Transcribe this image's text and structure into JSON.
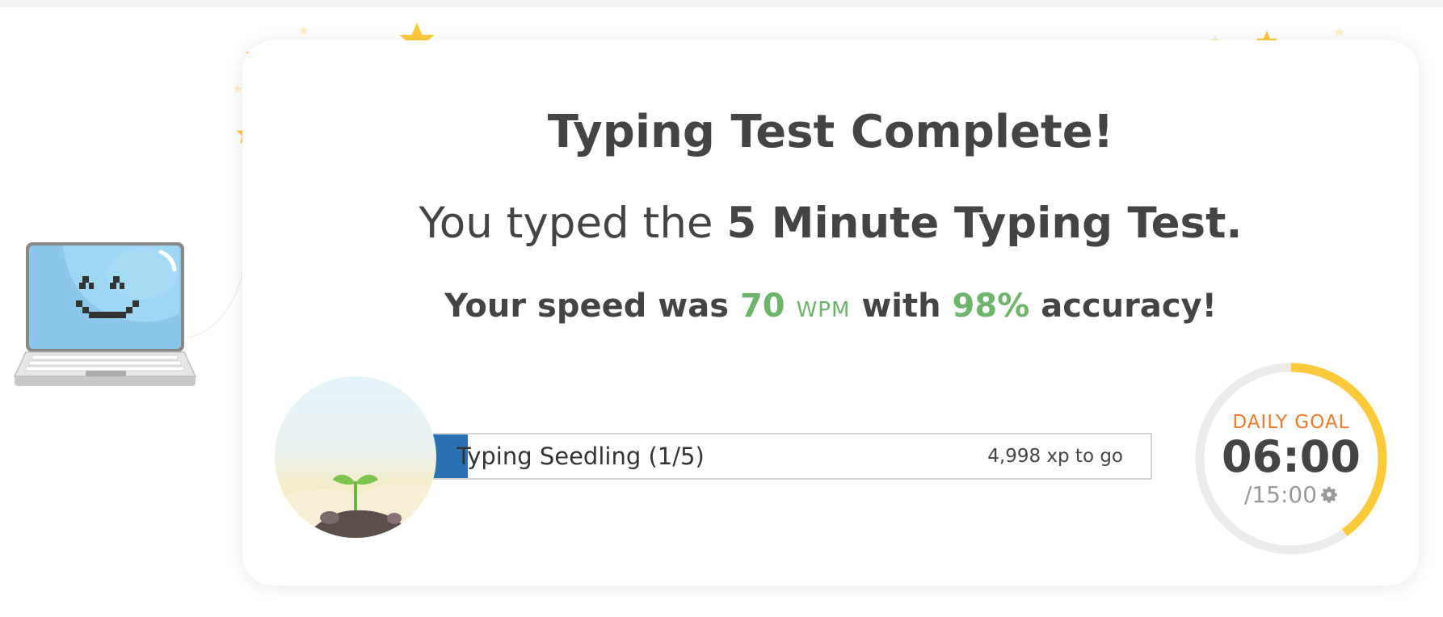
{
  "result": {
    "title": "Typing Test Complete!",
    "subtitle_prefix": "You typed the",
    "test_name": "5 Minute Typing Test.",
    "speed_prefix": "Your speed was",
    "wpm_value": "70",
    "wpm_unit": "WPM",
    "speed_middle": "with",
    "accuracy_value": "98%",
    "speed_suffix": "accuracy!"
  },
  "progress": {
    "level_label": "Typing Seedling (1/5)",
    "xp_to_go": "4,998 xp to go",
    "fill_fraction": 0.05
  },
  "daily_goal": {
    "label": "DAILY GOAL",
    "time": "06:00",
    "total": "/15:00",
    "progress_fraction": 0.4
  },
  "colors": {
    "accent_green": "#6cb56b",
    "progress_blue": "#2a71b4",
    "goal_orange": "#ee7a2c",
    "goal_ring_yellow": "#fcc93b",
    "star_yellow": "#fcc93b"
  },
  "icons": {
    "mascot": "smiling-laptop-icon",
    "badge": "seedling-icon",
    "settings": "gear-icon",
    "decoration": "star-icon"
  }
}
